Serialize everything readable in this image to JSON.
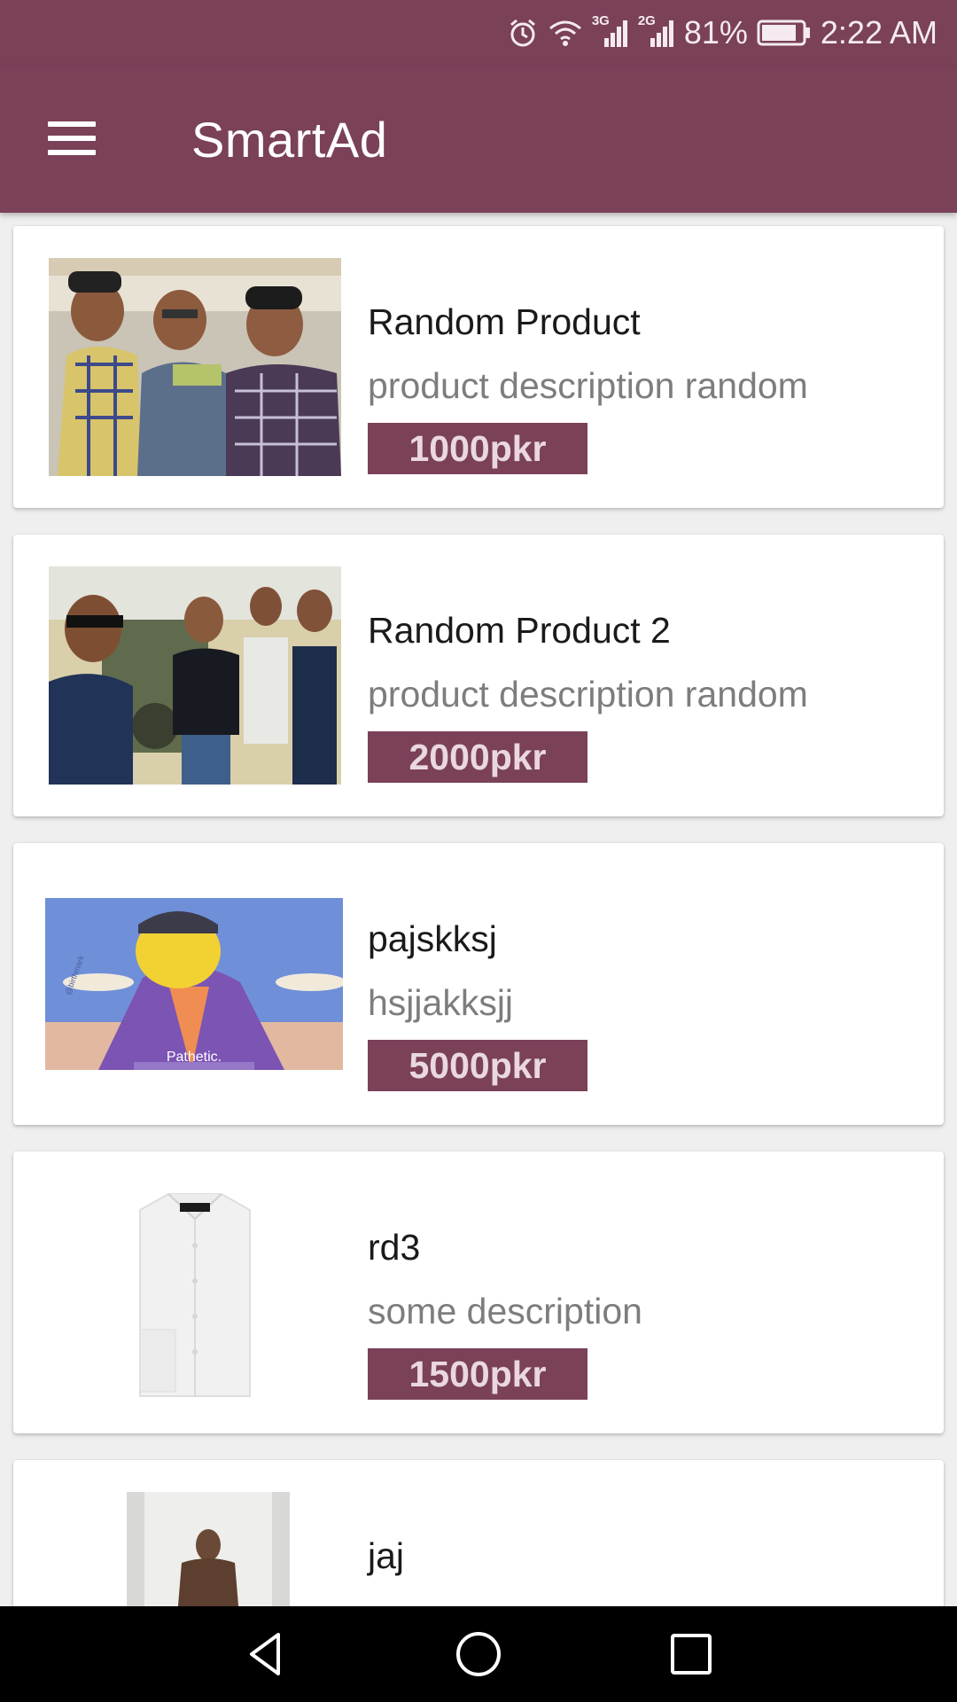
{
  "status_bar": {
    "network_1": "3G",
    "network_2": "2G",
    "battery_percent": "81%",
    "time": "2:22 AM",
    "icons": [
      "alarm-icon",
      "wifi-icon",
      "signal-icon",
      "signal-icon",
      "battery-icon"
    ]
  },
  "app_bar": {
    "title": "SmartAd",
    "menu_icon": "hamburger-icon"
  },
  "products": [
    {
      "name": "Random Product",
      "description": "product description random",
      "price": "1000pkr"
    },
    {
      "name": "Random Product 2",
      "description": "product description random",
      "price": "2000pkr"
    },
    {
      "name": "pajskksj",
      "description": "hsjjakksjj",
      "price": "5000pkr"
    },
    {
      "name": "rd3",
      "description": "some description",
      "price": "1500pkr"
    },
    {
      "name": "jaj",
      "description": "",
      "price": ""
    }
  ],
  "image_captions": {
    "cartoon_caption": "Pathetic.",
    "watermark": "@birthmark"
  },
  "nav_bar": {
    "icons": [
      "back-icon",
      "home-icon",
      "recents-icon"
    ]
  },
  "colors": {
    "primary": "#7a4159",
    "price_text": "#ead7e0",
    "background": "#efefef"
  }
}
